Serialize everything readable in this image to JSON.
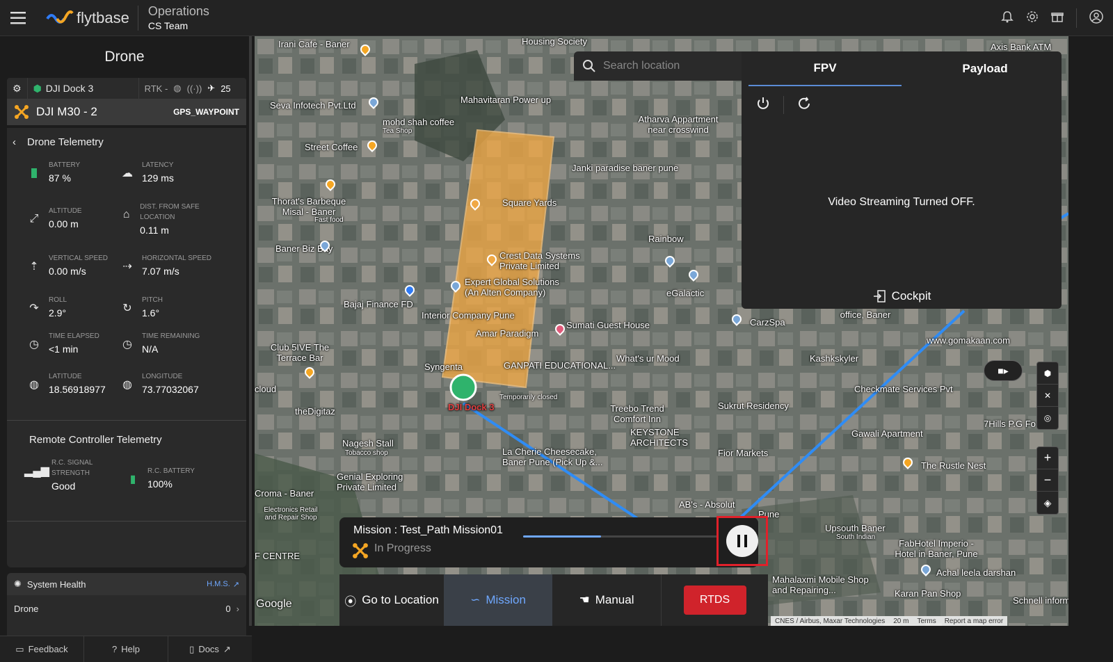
{
  "header": {
    "brand": "flytbase",
    "section_title": "Operations",
    "team": "CS Team"
  },
  "sidebar": {
    "title": "Drone",
    "dock_name": "DJI Dock 3",
    "rtk": "RTK -",
    "satellites": "25",
    "drone_name": "DJI M30 - 2",
    "drone_mode": "GPS_WAYPOINT",
    "telemetry_title": "Drone Telemetry",
    "telemetry": [
      {
        "label": "BATTERY",
        "value": "87 %",
        "icon": "battery-icon"
      },
      {
        "label": "LATENCY",
        "value": "129 ms",
        "icon": "cloud-icon"
      },
      {
        "label": "ALTITUDE",
        "value": "0.00 m",
        "icon": "altitude-icon"
      },
      {
        "label": "DIST. FROM SAFE LOCATION",
        "value": "0.11 m",
        "icon": "home-icon"
      },
      {
        "label": "VERTICAL SPEED",
        "value": "0.00 m/s",
        "icon": "vertical-speed-icon"
      },
      {
        "label": "HORIZONTAL SPEED",
        "value": "7.07 m/s",
        "icon": "horizontal-speed-icon"
      },
      {
        "label": "ROLL",
        "value": "2.9°",
        "icon": "roll-icon"
      },
      {
        "label": "PITCH",
        "value": "1.6°",
        "icon": "pitch-icon"
      },
      {
        "label": "TIME ELAPSED",
        "value": "<1 min",
        "icon": "clock-icon"
      },
      {
        "label": "TIME REMAINING",
        "value": "N/A",
        "icon": "clock-icon"
      },
      {
        "label": "LATITUDE",
        "value": "18.56918977",
        "icon": "globe-icon"
      },
      {
        "label": "LONGITUDE",
        "value": "73.77032067",
        "icon": "globe-icon"
      }
    ],
    "rc_title": "Remote Controller Telemetry",
    "rc": [
      {
        "label": "R.C. SIGNAL STRENGTH",
        "value": "Good"
      },
      {
        "label": "R.C. BATTERY",
        "value": "100%"
      }
    ],
    "health_title": "System Health",
    "hms": "H.M.S.",
    "health_rows": [
      {
        "name": "Drone",
        "count": "0"
      }
    ],
    "footer": {
      "feedback": "Feedback",
      "help": "Help",
      "docs": "Docs"
    }
  },
  "map": {
    "search_placeholder": "Search location",
    "labels": [
      "Irani Cafe - Baner",
      "Housing Society",
      "Axis Bank ATM",
      "Seva Infotech Pvt.Ltd",
      "Mahavitaran Power up",
      "mohd shah coffee",
      "Tea Shop",
      "Street Coffee",
      "Atharva Appartment near crosswind",
      "Janki paradise baner pune",
      "Thorat's Barbeque Misal - Baner",
      "Fast food",
      "Square Yards",
      "Baner Biz Bay",
      "Crest Data Systems Private Limited",
      "Rainbow",
      "Expert Global Solutions (An Alten Company)",
      "eGalactic",
      "Bajaj Finance FD",
      "Interior Company Pune",
      "Farmers for Forests office, Baner",
      "Sumati Guest House",
      "CarzSpa",
      "Amar Paradigm",
      "www.gomakaan.com",
      "Club 5IVE The Terrace Bar",
      "Syngenta",
      "GANPATI EDUCATIONAL...",
      "What's ur Mood",
      "Kashkskyler",
      "Temporarily closed",
      "DJI Dock 3",
      "Checkmate Services Pvt",
      "cloud",
      "theDigitaz",
      "Treebo Trend Comfort Inn",
      "Sukrut Residency",
      "7Hills P.G Fo",
      "Gawali Apartment",
      "Nagesh Stall",
      "Tobacco shop",
      "KEYSTONE ARCHITECTS",
      "Fior Markets",
      "The Rustle Nest",
      "La Cherie Cheesecake, Baner Pune (Pick Up &...",
      "Genial Exploring Private Limited",
      "Croma - Baner",
      "Electronics Retail and Repair Shop",
      "AB's - Absolut",
      "Pune",
      "Upsouth Baner",
      "South Indian",
      "FabHotel Imperio - Hotel in Baner, Pune",
      "Achal leela darshan",
      "Mahalaxmi Mobile Shop and Repairing...",
      "Karan Pan Shop",
      "Schnell inform",
      "Google",
      "F CENTRE"
    ],
    "attribution": [
      "CNES / Airbus, Maxar Technologies",
      "20 m",
      "Terms",
      "Report a map error"
    ]
  },
  "fpv": {
    "tabs": [
      "FPV",
      "Payload"
    ],
    "active_tab": "FPV",
    "message": "Video Streaming Turned OFF.",
    "cockpit": "Cockpit"
  },
  "mission": {
    "name": "Mission : Test_Path Mission01",
    "status": "In Progress",
    "progress": 0.4
  },
  "bottom_nav": {
    "go_to_location": "Go to Location",
    "mission": "Mission",
    "manual": "Manual",
    "rtds": "RTDS"
  },
  "colors": {
    "accent": "#6fa8ff",
    "danger": "#d0232b",
    "drone_orange": "#f5a623",
    "dock_green": "#2fb36c"
  }
}
